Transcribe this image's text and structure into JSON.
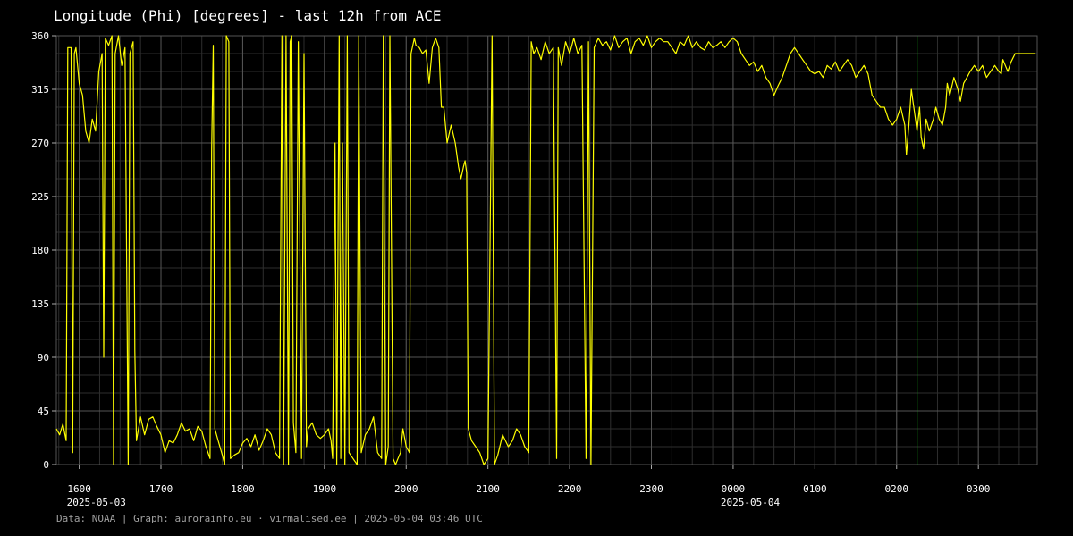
{
  "title": "Longitude (Phi) [degrees] - last 12h from ACE",
  "footer": "Data: NOAA | Graph: aurorainfo.eu · virmalised.ee | 2025-05-04 03:46 UTC",
  "colors": {
    "background": "#000000",
    "grid": "#444444",
    "line": "#ffff00",
    "marker": "#00ff00",
    "text": "#ffffff",
    "footer": "#a0a0a0"
  },
  "chart_data": {
    "type": "line",
    "title": "Longitude (Phi) [degrees] - last 12h from ACE",
    "ylim": [
      0,
      360
    ],
    "yticks": [
      "0",
      "45",
      "90",
      "135",
      "180",
      "225",
      "270",
      "315",
      "360"
    ],
    "xlim_hours": [
      15.72,
      27.72
    ],
    "xticks": [
      {
        "h": 16,
        "label": "1600",
        "date": "2025-05-03"
      },
      {
        "h": 17,
        "label": "1700",
        "date": ""
      },
      {
        "h": 18,
        "label": "1800",
        "date": ""
      },
      {
        "h": 19,
        "label": "1900",
        "date": ""
      },
      {
        "h": 20,
        "label": "2000",
        "date": ""
      },
      {
        "h": 21,
        "label": "2100",
        "date": ""
      },
      {
        "h": 22,
        "label": "2200",
        "date": ""
      },
      {
        "h": 23,
        "label": "2300",
        "date": ""
      },
      {
        "h": 24,
        "label": "0000",
        "date": "2025-05-04"
      },
      {
        "h": 25,
        "label": "0100",
        "date": ""
      },
      {
        "h": 26,
        "label": "0200",
        "date": ""
      },
      {
        "h": 27,
        "label": "0300",
        "date": ""
      }
    ],
    "marker_hour": 26.25,
    "grid": true,
    "series": [
      {
        "points": [
          [
            15.72,
            30
          ],
          [
            15.76,
            25
          ],
          [
            15.8,
            34
          ],
          [
            15.84,
            20
          ],
          [
            15.86,
            350
          ],
          [
            15.9,
            350
          ],
          [
            15.92,
            10
          ],
          [
            15.94,
            345
          ],
          [
            15.96,
            350
          ],
          [
            16.0,
            320
          ],
          [
            16.04,
            310
          ],
          [
            16.08,
            280
          ],
          [
            16.12,
            270
          ],
          [
            16.16,
            290
          ],
          [
            16.2,
            280
          ],
          [
            16.24,
            330
          ],
          [
            16.28,
            345
          ],
          [
            16.3,
            90
          ],
          [
            16.32,
            358
          ],
          [
            16.36,
            352
          ],
          [
            16.4,
            360
          ],
          [
            16.42,
            0
          ],
          [
            16.44,
            345
          ],
          [
            16.48,
            360
          ],
          [
            16.52,
            335
          ],
          [
            16.56,
            350
          ],
          [
            16.6,
            0
          ],
          [
            16.62,
            345
          ],
          [
            16.66,
            355
          ],
          [
            16.68,
            95
          ],
          [
            16.7,
            20
          ],
          [
            16.75,
            40
          ],
          [
            16.8,
            25
          ],
          [
            16.85,
            38
          ],
          [
            16.9,
            40
          ],
          [
            16.95,
            32
          ],
          [
            17.0,
            25
          ],
          [
            17.05,
            10
          ],
          [
            17.1,
            20
          ],
          [
            17.15,
            18
          ],
          [
            17.2,
            25
          ],
          [
            17.25,
            35
          ],
          [
            17.3,
            28
          ],
          [
            17.35,
            30
          ],
          [
            17.4,
            20
          ],
          [
            17.45,
            32
          ],
          [
            17.5,
            28
          ],
          [
            17.55,
            15
          ],
          [
            17.6,
            5
          ],
          [
            17.62,
            265
          ],
          [
            17.64,
            352
          ],
          [
            17.66,
            30
          ],
          [
            17.7,
            20
          ],
          [
            17.75,
            8
          ],
          [
            17.78,
            0
          ],
          [
            17.8,
            360
          ],
          [
            17.83,
            355
          ],
          [
            17.85,
            5
          ],
          [
            17.9,
            8
          ],
          [
            17.95,
            10
          ],
          [
            18.0,
            18
          ],
          [
            18.05,
            22
          ],
          [
            18.1,
            15
          ],
          [
            18.15,
            25
          ],
          [
            18.2,
            12
          ],
          [
            18.25,
            20
          ],
          [
            18.3,
            30
          ],
          [
            18.35,
            25
          ],
          [
            18.4,
            10
          ],
          [
            18.45,
            5
          ],
          [
            18.48,
            360
          ],
          [
            18.5,
            0
          ],
          [
            18.53,
            360
          ],
          [
            18.56,
            0
          ],
          [
            18.58,
            355
          ],
          [
            18.6,
            360
          ],
          [
            18.62,
            35
          ],
          [
            18.65,
            10
          ],
          [
            18.68,
            355
          ],
          [
            18.72,
            5
          ],
          [
            18.75,
            345
          ],
          [
            18.78,
            15
          ],
          [
            18.8,
            30
          ],
          [
            18.85,
            35
          ],
          [
            18.9,
            25
          ],
          [
            18.95,
            22
          ],
          [
            19.0,
            25
          ],
          [
            19.05,
            30
          ],
          [
            19.08,
            20
          ],
          [
            19.1,
            5
          ],
          [
            19.13,
            270
          ],
          [
            19.15,
            0
          ],
          [
            19.18,
            360
          ],
          [
            19.2,
            5
          ],
          [
            19.22,
            270
          ],
          [
            19.25,
            0
          ],
          [
            19.28,
            360
          ],
          [
            19.3,
            10
          ],
          [
            19.35,
            5
          ],
          [
            19.4,
            0
          ],
          [
            19.42,
            360
          ],
          [
            19.45,
            10
          ],
          [
            19.5,
            25
          ],
          [
            19.55,
            30
          ],
          [
            19.6,
            40
          ],
          [
            19.65,
            10
          ],
          [
            19.7,
            5
          ],
          [
            19.72,
            360
          ],
          [
            19.75,
            0
          ],
          [
            19.78,
            15
          ],
          [
            19.8,
            360
          ],
          [
            19.84,
            5
          ],
          [
            19.87,
            0
          ],
          [
            19.9,
            5
          ],
          [
            19.93,
            10
          ],
          [
            19.96,
            30
          ],
          [
            20.0,
            15
          ],
          [
            20.04,
            10
          ],
          [
            20.06,
            345
          ],
          [
            20.1,
            358
          ],
          [
            20.12,
            352
          ],
          [
            20.16,
            350
          ],
          [
            20.2,
            345
          ],
          [
            20.24,
            348
          ],
          [
            20.28,
            320
          ],
          [
            20.32,
            350
          ],
          [
            20.36,
            358
          ],
          [
            20.4,
            350
          ],
          [
            20.43,
            300
          ],
          [
            20.46,
            300
          ],
          [
            20.5,
            270
          ],
          [
            20.55,
            285
          ],
          [
            20.6,
            270
          ],
          [
            20.64,
            250
          ],
          [
            20.67,
            240
          ],
          [
            20.7,
            250
          ],
          [
            20.72,
            255
          ],
          [
            20.74,
            245
          ],
          [
            20.76,
            30
          ],
          [
            20.8,
            20
          ],
          [
            20.85,
            15
          ],
          [
            20.9,
            10
          ],
          [
            20.95,
            0
          ],
          [
            21.0,
            5
          ],
          [
            21.05,
            360
          ],
          [
            21.08,
            0
          ],
          [
            21.12,
            8
          ],
          [
            21.18,
            25
          ],
          [
            21.25,
            15
          ],
          [
            21.3,
            20
          ],
          [
            21.35,
            30
          ],
          [
            21.4,
            25
          ],
          [
            21.45,
            15
          ],
          [
            21.5,
            10
          ],
          [
            21.53,
            355
          ],
          [
            21.56,
            345
          ],
          [
            21.6,
            350
          ],
          [
            21.65,
            340
          ],
          [
            21.7,
            355
          ],
          [
            21.75,
            345
          ],
          [
            21.8,
            350
          ],
          [
            21.84,
            5
          ],
          [
            21.86,
            350
          ],
          [
            21.9,
            335
          ],
          [
            21.95,
            355
          ],
          [
            22.0,
            345
          ],
          [
            22.05,
            358
          ],
          [
            22.1,
            345
          ],
          [
            22.15,
            352
          ],
          [
            22.2,
            5
          ],
          [
            22.23,
            355
          ],
          [
            22.26,
            0
          ],
          [
            22.3,
            350
          ],
          [
            22.35,
            358
          ],
          [
            22.4,
            352
          ],
          [
            22.45,
            355
          ],
          [
            22.5,
            348
          ],
          [
            22.55,
            360
          ],
          [
            22.6,
            350
          ],
          [
            22.65,
            355
          ],
          [
            22.7,
            358
          ],
          [
            22.75,
            345
          ],
          [
            22.8,
            355
          ],
          [
            22.85,
            358
          ],
          [
            22.9,
            352
          ],
          [
            22.95,
            360
          ],
          [
            23.0,
            350
          ],
          [
            23.05,
            355
          ],
          [
            23.1,
            358
          ],
          [
            23.15,
            355
          ],
          [
            23.2,
            355
          ],
          [
            23.25,
            350
          ],
          [
            23.3,
            345
          ],
          [
            23.35,
            355
          ],
          [
            23.4,
            352
          ],
          [
            23.45,
            360
          ],
          [
            23.5,
            350
          ],
          [
            23.55,
            355
          ],
          [
            23.6,
            350
          ],
          [
            23.65,
            348
          ],
          [
            23.7,
            355
          ],
          [
            23.75,
            350
          ],
          [
            23.8,
            352
          ],
          [
            23.85,
            355
          ],
          [
            23.9,
            350
          ],
          [
            23.95,
            355
          ],
          [
            24.0,
            358
          ],
          [
            24.05,
            355
          ],
          [
            24.1,
            345
          ],
          [
            24.15,
            340
          ],
          [
            24.2,
            335
          ],
          [
            24.25,
            338
          ],
          [
            24.3,
            330
          ],
          [
            24.35,
            335
          ],
          [
            24.4,
            325
          ],
          [
            24.45,
            320
          ],
          [
            24.5,
            310
          ],
          [
            24.55,
            318
          ],
          [
            24.6,
            325
          ],
          [
            24.65,
            335
          ],
          [
            24.7,
            345
          ],
          [
            24.75,
            350
          ],
          [
            24.8,
            345
          ],
          [
            24.85,
            340
          ],
          [
            24.9,
            335
          ],
          [
            24.95,
            330
          ],
          [
            25.0,
            328
          ],
          [
            25.05,
            330
          ],
          [
            25.1,
            325
          ],
          [
            25.15,
            335
          ],
          [
            25.2,
            332
          ],
          [
            25.25,
            338
          ],
          [
            25.3,
            330
          ],
          [
            25.35,
            335
          ],
          [
            25.4,
            340
          ],
          [
            25.45,
            335
          ],
          [
            25.5,
            325
          ],
          [
            25.55,
            330
          ],
          [
            25.6,
            335
          ],
          [
            25.65,
            328
          ],
          [
            25.7,
            310
          ],
          [
            25.75,
            305
          ],
          [
            25.8,
            300
          ],
          [
            25.85,
            300
          ],
          [
            25.9,
            290
          ],
          [
            25.95,
            285
          ],
          [
            26.0,
            290
          ],
          [
            26.05,
            300
          ],
          [
            26.1,
            285
          ],
          [
            26.12,
            260
          ],
          [
            26.15,
            285
          ],
          [
            26.18,
            315
          ],
          [
            26.2,
            305
          ],
          [
            26.22,
            295
          ],
          [
            26.25,
            280
          ],
          [
            26.28,
            300
          ],
          [
            26.3,
            275
          ],
          [
            26.33,
            265
          ],
          [
            26.36,
            290
          ],
          [
            26.4,
            280
          ],
          [
            26.45,
            290
          ],
          [
            26.48,
            300
          ],
          [
            26.52,
            290
          ],
          [
            26.56,
            285
          ],
          [
            26.6,
            300
          ],
          [
            26.62,
            320
          ],
          [
            26.65,
            310
          ],
          [
            26.7,
            325
          ],
          [
            26.75,
            315
          ],
          [
            26.78,
            305
          ],
          [
            26.82,
            320
          ],
          [
            26.86,
            325
          ],
          [
            26.9,
            330
          ],
          [
            26.95,
            335
          ],
          [
            27.0,
            330
          ],
          [
            27.05,
            335
          ],
          [
            27.1,
            325
          ],
          [
            27.15,
            330
          ],
          [
            27.2,
            335
          ],
          [
            27.25,
            330
          ],
          [
            27.28,
            328
          ],
          [
            27.3,
            340
          ],
          [
            27.33,
            335
          ],
          [
            27.36,
            330
          ],
          [
            27.4,
            338
          ],
          [
            27.45,
            345
          ],
          [
            27.55,
            345
          ],
          [
            27.65,
            345
          ],
          [
            27.7,
            345
          ]
        ]
      }
    ]
  }
}
